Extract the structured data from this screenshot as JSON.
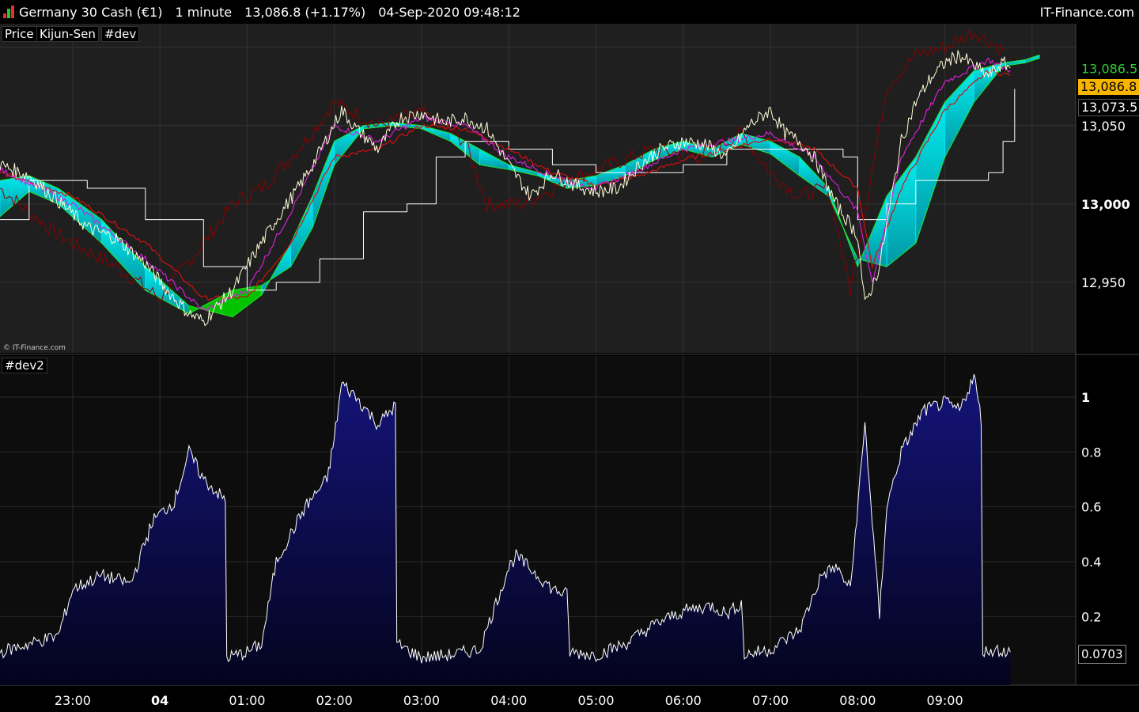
{
  "header": {
    "instrument": "Germany 30 Cash (€1)",
    "timeframe": "1 minute",
    "quote": "13,086.8 (+1.17%)",
    "datetime": "04-Sep-2020 09:48:12",
    "brand": "IT-Finance.com",
    "icon": "candle-bars-icon"
  },
  "tags": {
    "price": "Price",
    "kijun": "Kijun-Sen",
    "dev": "#dev",
    "dev2": "#dev2"
  },
  "watermark": "© IT-Finance.com",
  "badges": {
    "last": "13,086.8",
    "kijun": "13,073.5",
    "dev2_last": "0.0703"
  },
  "colors": {
    "background": "#1e1e1e",
    "price_line": "#fffdd8",
    "magenta_line": "#d020d0",
    "red_line": "#d01010",
    "dark_red_line": "#8a0000",
    "white_line": "#ffffff",
    "cloud_bull": "#00e5ff",
    "cloud_bear": "#00d000",
    "dev_fill": "#0a0a60",
    "last_price_badge": "#f7b500"
  },
  "chart_data": [
    {
      "type": "line",
      "panel": "price",
      "x_ticks": [
        "23:00",
        "04",
        "01:00",
        "02:00",
        "03:00",
        "04:00",
        "05:00",
        "06:00",
        "07:00",
        "08:00",
        "09:00"
      ],
      "y_ticks": [
        "12,950",
        "13,000",
        "13,050",
        "13,086.5"
      ],
      "ylim": [
        12905,
        13115
      ],
      "time_range": [
        "22:10",
        "09:48"
      ],
      "series": [
        {
          "key": "price",
          "times": [
            "22:10",
            "22:30",
            "22:50",
            "23:10",
            "23:30",
            "23:50",
            "00:05",
            "00:20",
            "00:30",
            "00:40",
            "00:50",
            "01:05",
            "01:20",
            "01:35",
            "01:45",
            "01:55",
            "02:05",
            "02:15",
            "02:30",
            "02:45",
            "03:00",
            "03:15",
            "03:30",
            "03:45",
            "04:00",
            "04:15",
            "04:30",
            "04:45",
            "05:00",
            "05:15",
            "05:30",
            "05:45",
            "06:00",
            "06:15",
            "06:30",
            "06:45",
            "07:00",
            "07:10",
            "07:20",
            "07:30",
            "07:45",
            "08:00",
            "08:05",
            "08:15",
            "08:30",
            "08:40",
            "08:50",
            "09:00",
            "09:10",
            "09:20",
            "09:30",
            "09:40",
            "09:45"
          ],
          "values": [
            13025,
            13018,
            13002,
            12985,
            12978,
            12962,
            12945,
            12930,
            12925,
            12935,
            12945,
            12968,
            12990,
            13010,
            13025,
            13042,
            13060,
            13048,
            13035,
            13055,
            13058,
            13052,
            13055,
            13048,
            13025,
            13005,
            13020,
            13012,
            13008,
            13010,
            13025,
            13035,
            13040,
            13038,
            13030,
            13050,
            13060,
            13045,
            13040,
            13030,
            13000,
            12980,
            12935,
            12960,
            13040,
            13065,
            13080,
            13090,
            13095,
            13088,
            13082,
            13090,
            13086.8
          ]
        },
        {
          "key": "magenta",
          "times": [
            "22:10",
            "23:00",
            "23:50",
            "00:30",
            "01:00",
            "01:30",
            "02:00",
            "02:30",
            "03:00",
            "03:30",
            "04:00",
            "04:30",
            "05:00",
            "05:30",
            "06:00",
            "06:30",
            "07:00",
            "07:30",
            "08:00",
            "08:10",
            "08:30",
            "09:00",
            "09:30",
            "09:45"
          ],
          "values": [
            13022,
            13000,
            12965,
            12932,
            12945,
            12995,
            13050,
            13040,
            13055,
            13050,
            13030,
            13018,
            13010,
            13022,
            13035,
            13040,
            13045,
            13030,
            12995,
            12950,
            13030,
            13078,
            13092,
            13085
          ]
        },
        {
          "key": "red",
          "times": [
            "22:10",
            "23:00",
            "23:50",
            "00:30",
            "01:00",
            "01:30",
            "02:00",
            "02:30",
            "03:00",
            "03:30",
            "04:00",
            "04:30",
            "05:00",
            "05:30",
            "06:00",
            "06:30",
            "07:00",
            "07:30",
            "08:00",
            "08:10",
            "08:30",
            "09:00",
            "09:30",
            "09:45"
          ],
          "values": [
            13020,
            13005,
            12975,
            12940,
            12940,
            12975,
            13030,
            13035,
            13050,
            13048,
            13035,
            13020,
            13012,
            13018,
            13028,
            13035,
            13042,
            13035,
            13010,
            12960,
            13010,
            13060,
            13085,
            13082
          ]
        },
        {
          "key": "dark_red",
          "times": [
            "22:10",
            "22:50",
            "23:30",
            "00:00",
            "00:30",
            "00:50",
            "01:10",
            "01:40",
            "02:00",
            "02:30",
            "03:00",
            "03:30",
            "03:45",
            "04:10",
            "04:40",
            "05:10",
            "05:40",
            "06:10",
            "06:40",
            "07:00",
            "07:20",
            "07:40",
            "07:55",
            "08:05",
            "08:20",
            "08:40",
            "09:00",
            "09:20",
            "09:40"
          ],
          "values": [
            13010,
            12980,
            12960,
            12940,
            12975,
            13000,
            13010,
            13040,
            13065,
            13050,
            13058,
            13040,
            13000,
            13000,
            13015,
            13025,
            13035,
            13030,
            13045,
            13020,
            13005,
            13010,
            12945,
            12995,
            13075,
            13095,
            13100,
            13110,
            13098
          ]
        },
        {
          "key": "white",
          "times": [
            "22:10",
            "22:30",
            "23:10",
            "23:50",
            "00:30",
            "01:00",
            "01:20",
            "01:50",
            "02:20",
            "02:50",
            "03:10",
            "03:30",
            "04:00",
            "04:30",
            "05:00",
            "05:30",
            "06:00",
            "06:30",
            "07:00",
            "07:30",
            "07:50",
            "08:00",
            "08:20",
            "08:40",
            "09:00",
            "09:30",
            "09:40",
            "09:48"
          ],
          "values": [
            12990,
            13015,
            13010,
            12990,
            12960,
            12945,
            12950,
            12965,
            12995,
            13000,
            13030,
            13040,
            13035,
            13025,
            13020,
            13020,
            13025,
            13035,
            13035,
            13035,
            13030,
            12990,
            13000,
            13015,
            13015,
            13020,
            13040,
            13073.5
          ]
        },
        {
          "key": "cloud",
          "times": [
            "22:10",
            "22:30",
            "22:50",
            "23:20",
            "23:50",
            "00:20",
            "00:50",
            "01:10",
            "01:30",
            "01:45",
            "02:00",
            "02:20",
            "02:40",
            "03:00",
            "03:20",
            "03:40",
            "04:00",
            "04:20",
            "04:40",
            "05:00",
            "05:20",
            "05:40",
            "06:00",
            "06:20",
            "06:40",
            "07:00",
            "07:20",
            "07:40",
            "08:00",
            "08:20",
            "08:40",
            "09:00",
            "09:20",
            "09:40",
            "09:55",
            "10:05"
          ],
          "span_a": [
            13015,
            13018,
            13010,
            12990,
            12960,
            12935,
            12928,
            12942,
            12975,
            13005,
            13040,
            13050,
            13052,
            13050,
            13045,
            13035,
            13025,
            13020,
            13015,
            13018,
            13025,
            13035,
            13040,
            13035,
            13045,
            13040,
            13030,
            13010,
            12960,
            13005,
            13030,
            13065,
            13085,
            13090,
            13092,
            13095
          ],
          "span_b": [
            12992,
            13008,
            13000,
            12975,
            12945,
            12930,
            12945,
            12948,
            12960,
            12985,
            13025,
            13048,
            13050,
            13048,
            13040,
            13025,
            13022,
            13018,
            13010,
            13012,
            13018,
            13028,
            13035,
            13030,
            13038,
            13032,
            13018,
            13005,
            12965,
            12960,
            12975,
            13030,
            13065,
            13088,
            13090,
            13093
          ]
        }
      ]
    },
    {
      "type": "area",
      "panel": "dev2",
      "y_ticks": [
        0.2,
        0.4,
        0.6,
        0.8,
        1
      ],
      "ylim": [
        -0.05,
        1.15
      ],
      "times": [
        "22:10",
        "22:30",
        "22:50",
        "23:00",
        "23:20",
        "23:40",
        "23:55",
        "00:10",
        "00:20",
        "00:30",
        "00:40",
        "00:45",
        "00:46",
        "01:00",
        "01:10",
        "01:20",
        "01:40",
        "01:55",
        "02:00",
        "02:05",
        "02:15",
        "02:30",
        "02:42",
        "02:43",
        "03:00",
        "03:20",
        "03:40",
        "04:00",
        "04:05",
        "04:20",
        "04:30",
        "04:40",
        "04:42",
        "05:00",
        "05:20",
        "05:40",
        "06:00",
        "06:20",
        "06:30",
        "06:40",
        "06:42",
        "07:00",
        "07:20",
        "07:35",
        "07:45",
        "07:55",
        "08:05",
        "08:10",
        "08:15",
        "08:20",
        "08:30",
        "08:45",
        "09:00",
        "09:10",
        "09:20",
        "09:25",
        "09:26",
        "09:35",
        "09:45"
      ],
      "values": [
        0.07,
        0.1,
        0.13,
        0.3,
        0.35,
        0.32,
        0.55,
        0.62,
        0.8,
        0.7,
        0.65,
        0.62,
        0.05,
        0.07,
        0.1,
        0.4,
        0.6,
        0.7,
        0.85,
        1.05,
        1.0,
        0.9,
        0.97,
        0.1,
        0.05,
        0.06,
        0.08,
        0.38,
        0.42,
        0.35,
        0.3,
        0.28,
        0.07,
        0.06,
        0.1,
        0.17,
        0.22,
        0.24,
        0.21,
        0.25,
        0.06,
        0.08,
        0.15,
        0.35,
        0.38,
        0.3,
        0.9,
        0.55,
        0.2,
        0.6,
        0.8,
        0.95,
        0.98,
        0.95,
        1.08,
        0.92,
        0.07,
        0.08,
        0.0703
      ]
    }
  ]
}
